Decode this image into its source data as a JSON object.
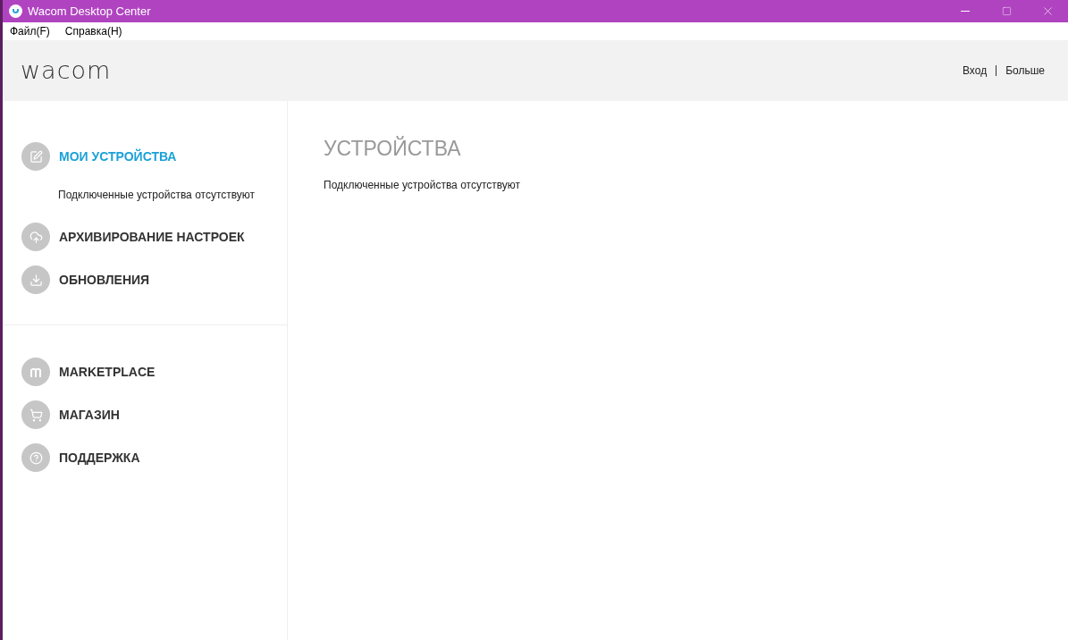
{
  "window": {
    "title": "Wacom Desktop Center"
  },
  "menu": [
    "Файл(F)",
    "Справка(H)"
  ],
  "header": {
    "logo": "wacom",
    "links": [
      "Вход",
      "Больше"
    ]
  },
  "sidebar": {
    "groups": [
      {
        "items": [
          {
            "label": "МОИ УСТРОЙСТВА",
            "selected": true,
            "subtitle": "Подключенные устройства отсутствуют"
          },
          {
            "label": "АРХИВИРОВАНИЕ НАСТРОЕК",
            "selected": false
          },
          {
            "label": "ОБНОВЛЕНИЯ",
            "selected": false
          }
        ]
      },
      {
        "items": [
          {
            "label": "MARKETPLACE",
            "selected": false
          },
          {
            "label": "МАГАЗИН",
            "selected": false
          },
          {
            "label": "ПОДДЕРЖКА",
            "selected": false
          }
        ]
      }
    ]
  },
  "content": {
    "title": "УСТРОЙСТВА",
    "message": "Подключенные устройства отсутствуют"
  }
}
